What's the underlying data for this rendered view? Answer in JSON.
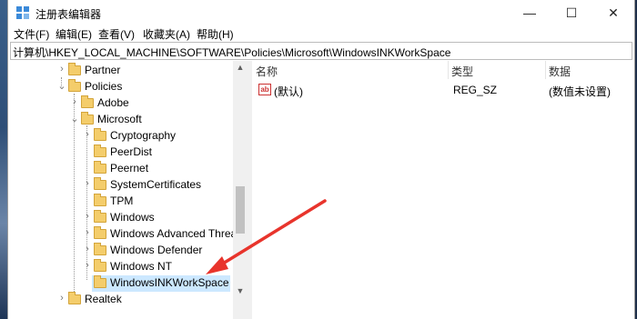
{
  "window": {
    "title": "注册表编辑器",
    "minimize": "—",
    "maximize": "☐",
    "close": "✕"
  },
  "menu": [
    "文件(F)",
    "编辑(E)",
    "查看(V)",
    "收藏夹(A)",
    "帮助(H)"
  ],
  "address": "计算机\\HKEY_LOCAL_MACHINE\\SOFTWARE\\Policies\\Microsoft\\WindowsINKWorkSpace",
  "tree": {
    "items": [
      {
        "label": "Partner",
        "expander": "collapsed"
      },
      {
        "label": "Policies",
        "expander": "expanded"
      },
      {
        "label": "Adobe",
        "expander": "collapsed"
      },
      {
        "label": "Microsoft",
        "expander": "expanded"
      },
      {
        "label": "Cryptography",
        "expander": "collapsed"
      },
      {
        "label": "PeerDist",
        "expander": "none"
      },
      {
        "label": "Peernet",
        "expander": "none"
      },
      {
        "label": "SystemCertificates",
        "expander": "collapsed"
      },
      {
        "label": "TPM",
        "expander": "none"
      },
      {
        "label": "Windows",
        "expander": "collapsed"
      },
      {
        "label": "Windows Advanced Threa",
        "expander": "collapsed"
      },
      {
        "label": "Windows Defender",
        "expander": "collapsed"
      },
      {
        "label": "Windows NT",
        "expander": "collapsed"
      },
      {
        "label": "WindowsINKWorkSpace",
        "expander": "none",
        "selected": true
      },
      {
        "label": "Realtek",
        "expander": "collapsed"
      }
    ]
  },
  "list": {
    "columns": [
      "名称",
      "类型",
      "数据"
    ],
    "rows": [
      {
        "icon": "string-value-icon",
        "icon_text": "ab",
        "name": "(默认)",
        "type": "REG_SZ",
        "data": "(数值未设置)"
      }
    ]
  },
  "colors": {
    "selection": "#cce8ff",
    "arrow": "#e8342c",
    "folder": "#f4cd6b"
  }
}
